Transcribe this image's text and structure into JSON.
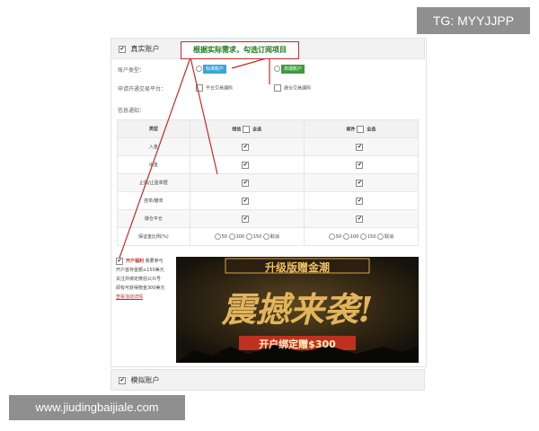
{
  "watermark_top": "TG: MYYJJPP",
  "watermark_bottom": "www.jiudingbaijiale.com",
  "real_account": {
    "title": "真实账户",
    "account_type_label": "账户类型：",
    "type_options": [
      "标准账户",
      "高端账户"
    ],
    "platform_label": "申请开通交易平台：",
    "platform_options": [
      "平台交易编码",
      "建仓交易编码"
    ],
    "notify_label": "信息通知："
  },
  "annotation": "根据实际需求，勾选订阅项目",
  "table": {
    "headers": [
      "类型",
      "短信",
      "全选",
      "邮件",
      "全选"
    ],
    "rows": [
      "入金",
      "出金",
      "止损/止盈单据",
      "挂单/撤单",
      "爆仓平仓",
      "保证金比例(%)"
    ],
    "ratio_options": [
      "50",
      "100",
      "150",
      "取消"
    ],
    "check_mark": "✔"
  },
  "promo": {
    "checkbox_label": "开户福利",
    "checkbox_tail": "我要参与",
    "lines": [
      "开户首存金额≥150美元",
      "关注并绑定微信公众号",
      "即有可获得赠金300美元"
    ],
    "link": "查看活动详情",
    "banner_top": "升级版赠金潮",
    "banner_main": "震撼来袭!",
    "banner_bottom": "开户绑定赠$300"
  },
  "demo_account": {
    "title": "模拟账户"
  },
  "colors": {
    "pill_blue": "#3aa6d8",
    "pill_green": "#3a9d3a",
    "annotation_red": "#c42a2a",
    "banner_gold": "#d8a64a"
  }
}
